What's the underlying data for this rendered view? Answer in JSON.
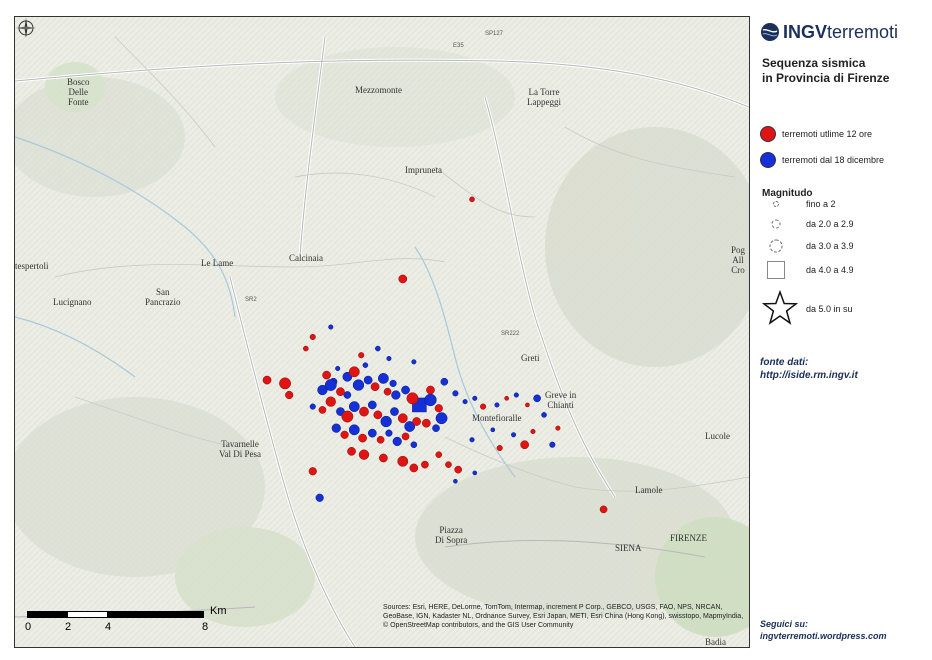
{
  "brand": {
    "logo_bold": "INGV",
    "logo_rest": "terremoti"
  },
  "title": [
    "Sequenza sismica",
    "in Provincia di Firenze"
  ],
  "legend": {
    "red_label": "terremoti utlime 12 ore",
    "blue_label": "terremoti dal 18 dicembre",
    "red_color": "#e11414",
    "blue_color": "#1430d6"
  },
  "magnitude": {
    "title": "Magnitudo",
    "classes": [
      "fino a 2",
      "da 2.0 a 2.9",
      "da 3.0 a 3.9",
      "da 4.0 a 4.9",
      "da 5.0 in su"
    ]
  },
  "fonte": [
    "fonte dati:",
    "http://iside.rm.ingv.it"
  ],
  "seguici": [
    "Seguici su:",
    "ingvterremoti.wordpress.com"
  ],
  "scale": {
    "unit": "Km",
    "ticks": [
      "0",
      "2",
      "4",
      "8"
    ]
  },
  "credits": "Sources: Esri, HERE, DeLorme, TomTom, Intermap, increment P Corp., GEBCO, USGS, FAO, NPS, NRCAN, GeoBase, IGN, Kadaster NL, Ordnance Survey, Esri Japan, METI, Esri China (Hong Kong), swisstopo, MapmyIndia, © OpenStreetMap contributors, and the GIS User Community",
  "places": {
    "bosco": "Bosco\nDelle\nFonte",
    "mezzomonte": "Mezzomonte",
    "la_torre": "La Torre\nLappeggi",
    "impruneta": "Impruneta",
    "calcinaia": "Calcinaia",
    "le_lame": "Le Lame",
    "tespertoli": "tespertoli",
    "lucignano": "Lucignano",
    "san_pancrazio": "San\nPancrazio",
    "greti": "Greti",
    "greve": "Greve in\nChianti",
    "montefioralle": "Montefioralle",
    "tavarnelle": "Tavarnelle\nVal Di Pesa",
    "lamole": "Lamole",
    "lucolena": "Lucole",
    "piazza": "Piazza\nDi Sopra",
    "poggio": "Pog\nAll\nCro",
    "firenze_road": "FIRENZE",
    "siena_road": "SIENA",
    "badia": "Badia"
  },
  "road_labels": {
    "e35": "E35",
    "sp127": "SP127",
    "sr2": "SR2",
    "sr222": "SR222"
  },
  "quakes": [
    {
      "lon": 11.31,
      "lat": 43.642,
      "c": "r",
      "m": 2.0
    },
    {
      "lon": 11.245,
      "lat": 43.607,
      "c": "r",
      "m": 1.5
    },
    {
      "lon": 11.24,
      "lat": 43.6,
      "c": "r",
      "m": 1.4
    },
    {
      "lon": 11.212,
      "lat": 43.581,
      "c": "r",
      "m": 2.0
    },
    {
      "lon": 11.225,
      "lat": 43.579,
      "c": "r",
      "m": 2.6
    },
    {
      "lon": 11.228,
      "lat": 43.572,
      "c": "r",
      "m": 1.9
    },
    {
      "lon": 11.252,
      "lat": 43.575,
      "c": "b",
      "m": 2.3
    },
    {
      "lon": 11.26,
      "lat": 43.58,
      "c": "b",
      "m": 1.8
    },
    {
      "lon": 11.27,
      "lat": 43.583,
      "c": "b",
      "m": 2.2
    },
    {
      "lon": 11.275,
      "lat": 43.586,
      "c": "r",
      "m": 2.4
    },
    {
      "lon": 11.283,
      "lat": 43.59,
      "c": "b",
      "m": 1.4
    },
    {
      "lon": 11.263,
      "lat": 43.588,
      "c": "b",
      "m": 1.3
    },
    {
      "lon": 11.255,
      "lat": 43.584,
      "c": "r",
      "m": 2.0
    },
    {
      "lon": 11.258,
      "lat": 43.578,
      "c": "b",
      "m": 2.6
    },
    {
      "lon": 11.265,
      "lat": 43.574,
      "c": "r",
      "m": 2.0
    },
    {
      "lon": 11.27,
      "lat": 43.572,
      "c": "b",
      "m": 1.8
    },
    {
      "lon": 11.278,
      "lat": 43.578,
      "c": "b",
      "m": 2.5
    },
    {
      "lon": 11.285,
      "lat": 43.581,
      "c": "b",
      "m": 2.0
    },
    {
      "lon": 11.29,
      "lat": 43.577,
      "c": "r",
      "m": 2.0
    },
    {
      "lon": 11.296,
      "lat": 43.582,
      "c": "b",
      "m": 2.4
    },
    {
      "lon": 11.303,
      "lat": 43.579,
      "c": "b",
      "m": 1.7
    },
    {
      "lon": 11.299,
      "lat": 43.574,
      "c": "r",
      "m": 1.8
    },
    {
      "lon": 11.305,
      "lat": 43.572,
      "c": "b",
      "m": 2.1
    },
    {
      "lon": 11.312,
      "lat": 43.575,
      "c": "b",
      "m": 2.0
    },
    {
      "lon": 11.317,
      "lat": 43.57,
      "c": "r",
      "m": 2.6
    },
    {
      "lon": 11.322,
      "lat": 43.566,
      "c": "b",
      "m": 4.0
    },
    {
      "lon": 11.33,
      "lat": 43.569,
      "c": "b",
      "m": 2.7
    },
    {
      "lon": 11.33,
      "lat": 43.575,
      "c": "r",
      "m": 2.0
    },
    {
      "lon": 11.336,
      "lat": 43.564,
      "c": "r",
      "m": 1.9
    },
    {
      "lon": 11.338,
      "lat": 43.558,
      "c": "b",
      "m": 2.6
    },
    {
      "lon": 11.334,
      "lat": 43.552,
      "c": "b",
      "m": 1.8
    },
    {
      "lon": 11.327,
      "lat": 43.555,
      "c": "r",
      "m": 2.0
    },
    {
      "lon": 11.245,
      "lat": 43.565,
      "c": "b",
      "m": 1.5
    },
    {
      "lon": 11.252,
      "lat": 43.563,
      "c": "r",
      "m": 1.8
    },
    {
      "lon": 11.258,
      "lat": 43.568,
      "c": "r",
      "m": 2.3
    },
    {
      "lon": 11.265,
      "lat": 43.562,
      "c": "b",
      "m": 2.0
    },
    {
      "lon": 11.27,
      "lat": 43.559,
      "c": "r",
      "m": 2.6
    },
    {
      "lon": 11.275,
      "lat": 43.565,
      "c": "b",
      "m": 2.4
    },
    {
      "lon": 11.282,
      "lat": 43.562,
      "c": "r",
      "m": 2.2
    },
    {
      "lon": 11.288,
      "lat": 43.566,
      "c": "b",
      "m": 2.0
    },
    {
      "lon": 11.292,
      "lat": 43.56,
      "c": "r",
      "m": 2.0
    },
    {
      "lon": 11.298,
      "lat": 43.556,
      "c": "b",
      "m": 2.5
    },
    {
      "lon": 11.304,
      "lat": 43.562,
      "c": "b",
      "m": 2.0
    },
    {
      "lon": 11.31,
      "lat": 43.558,
      "c": "r",
      "m": 2.2
    },
    {
      "lon": 11.315,
      "lat": 43.553,
      "c": "b",
      "m": 2.4
    },
    {
      "lon": 11.32,
      "lat": 43.556,
      "c": "r",
      "m": 2.0
    },
    {
      "lon": 11.262,
      "lat": 43.552,
      "c": "b",
      "m": 2.1
    },
    {
      "lon": 11.268,
      "lat": 43.548,
      "c": "r",
      "m": 1.9
    },
    {
      "lon": 11.275,
      "lat": 43.551,
      "c": "b",
      "m": 2.4
    },
    {
      "lon": 11.281,
      "lat": 43.546,
      "c": "r",
      "m": 2.0
    },
    {
      "lon": 11.288,
      "lat": 43.549,
      "c": "b",
      "m": 2.0
    },
    {
      "lon": 11.294,
      "lat": 43.545,
      "c": "r",
      "m": 1.8
    },
    {
      "lon": 11.3,
      "lat": 43.549,
      "c": "b",
      "m": 1.7
    },
    {
      "lon": 11.306,
      "lat": 43.544,
      "c": "b",
      "m": 2.1
    },
    {
      "lon": 11.312,
      "lat": 43.547,
      "c": "r",
      "m": 1.8
    },
    {
      "lon": 11.318,
      "lat": 43.542,
      "c": "b",
      "m": 1.6
    },
    {
      "lon": 11.273,
      "lat": 43.538,
      "c": "r",
      "m": 2.0
    },
    {
      "lon": 11.282,
      "lat": 43.536,
      "c": "r",
      "m": 2.3
    },
    {
      "lon": 11.296,
      "lat": 43.534,
      "c": "r",
      "m": 2.0
    },
    {
      "lon": 11.31,
      "lat": 43.532,
      "c": "r",
      "m": 2.4
    },
    {
      "lon": 11.318,
      "lat": 43.528,
      "c": "r",
      "m": 2.0
    },
    {
      "lon": 11.326,
      "lat": 43.53,
      "c": "r",
      "m": 1.8
    },
    {
      "lon": 11.336,
      "lat": 43.536,
      "c": "r",
      "m": 1.6
    },
    {
      "lon": 11.343,
      "lat": 43.53,
      "c": "r",
      "m": 1.6
    },
    {
      "lon": 11.35,
      "lat": 43.527,
      "c": "r",
      "m": 1.8
    },
    {
      "lon": 11.245,
      "lat": 43.526,
      "c": "r",
      "m": 1.9
    },
    {
      "lon": 11.25,
      "lat": 43.51,
      "c": "b",
      "m": 1.9
    },
    {
      "lon": 11.34,
      "lat": 43.58,
      "c": "b",
      "m": 1.8
    },
    {
      "lon": 11.348,
      "lat": 43.573,
      "c": "b",
      "m": 1.5
    },
    {
      "lon": 11.355,
      "lat": 43.568,
      "c": "b",
      "m": 1.3
    },
    {
      "lon": 11.362,
      "lat": 43.57,
      "c": "b",
      "m": 1.3
    },
    {
      "lon": 11.368,
      "lat": 43.565,
      "c": "r",
      "m": 1.5
    },
    {
      "lon": 11.378,
      "lat": 43.566,
      "c": "b",
      "m": 1.3
    },
    {
      "lon": 11.385,
      "lat": 43.57,
      "c": "r",
      "m": 1.2
    },
    {
      "lon": 11.392,
      "lat": 43.572,
      "c": "b",
      "m": 1.3
    },
    {
      "lon": 11.4,
      "lat": 43.566,
      "c": "r",
      "m": 1.2
    },
    {
      "lon": 11.407,
      "lat": 43.57,
      "c": "b",
      "m": 1.8
    },
    {
      "lon": 11.412,
      "lat": 43.56,
      "c": "b",
      "m": 1.4
    },
    {
      "lon": 11.404,
      "lat": 43.55,
      "c": "r",
      "m": 1.3
    },
    {
      "lon": 11.39,
      "lat": 43.548,
      "c": "b",
      "m": 1.3
    },
    {
      "lon": 11.375,
      "lat": 43.551,
      "c": "b",
      "m": 1.2
    },
    {
      "lon": 11.38,
      "lat": 43.54,
      "c": "r",
      "m": 1.5
    },
    {
      "lon": 11.398,
      "lat": 43.542,
      "c": "r",
      "m": 2.0
    },
    {
      "lon": 11.418,
      "lat": 43.542,
      "c": "b",
      "m": 1.5
    },
    {
      "lon": 11.422,
      "lat": 43.552,
      "c": "r",
      "m": 1.3
    },
    {
      "lon": 11.36,
      "lat": 43.545,
      "c": "b",
      "m": 1.3
    },
    {
      "lon": 11.348,
      "lat": 43.52,
      "c": "b",
      "m": 1.2
    },
    {
      "lon": 11.362,
      "lat": 43.525,
      "c": "b",
      "m": 1.2
    },
    {
      "lon": 11.292,
      "lat": 43.6,
      "c": "b",
      "m": 1.4
    },
    {
      "lon": 11.3,
      "lat": 43.594,
      "c": "b",
      "m": 1.3
    },
    {
      "lon": 11.318,
      "lat": 43.592,
      "c": "b",
      "m": 1.3
    },
    {
      "lon": 11.258,
      "lat": 43.613,
      "c": "b",
      "m": 1.3
    },
    {
      "lon": 11.28,
      "lat": 43.596,
      "c": "r",
      "m": 1.5
    },
    {
      "lon": 11.36,
      "lat": 43.69,
      "c": "r",
      "m": 1.4
    },
    {
      "lon": 11.455,
      "lat": 43.503,
      "c": "r",
      "m": 1.8
    }
  ]
}
